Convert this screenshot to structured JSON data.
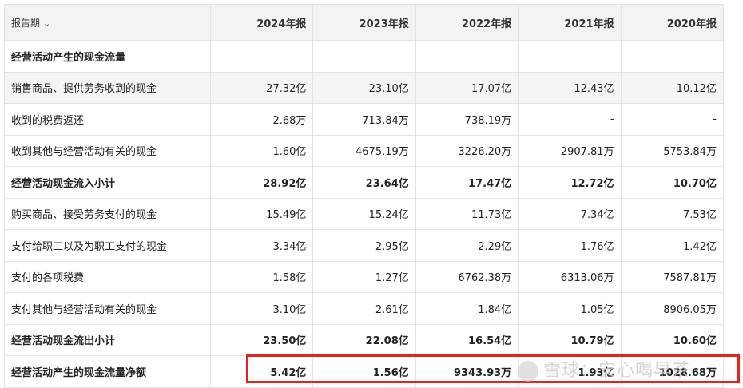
{
  "header": {
    "period_label": "报告期",
    "years": [
      "2024年报",
      "2023年报",
      "2022年报",
      "2021年报",
      "2020年报"
    ]
  },
  "rows": [
    {
      "name": "经营活动产生的现金流量",
      "values": [
        "",
        "",
        "",
        "",
        ""
      ]
    },
    {
      "name": "销售商品、提供劳务收到的现金",
      "values": [
        "27.32亿",
        "23.10亿",
        "17.07亿",
        "12.43亿",
        "10.12亿"
      ]
    },
    {
      "name": "收到的税费返还",
      "values": [
        "2.68万",
        "713.84万",
        "738.19万",
        "-",
        "-"
      ]
    },
    {
      "name": "收到其他与经营活动有关的现金",
      "values": [
        "1.60亿",
        "4675.19万",
        "3226.20万",
        "2907.81万",
        "5753.84万"
      ]
    },
    {
      "name": "经营活动现金流入小计",
      "values": [
        "28.92亿",
        "23.64亿",
        "17.47亿",
        "12.72亿",
        "10.70亿"
      ]
    },
    {
      "name": "购买商品、接受劳务支付的现金",
      "values": [
        "15.49亿",
        "15.24亿",
        "11.73亿",
        "7.34亿",
        "7.53亿"
      ]
    },
    {
      "name": "支付给职工以及为职工支付的现金",
      "values": [
        "3.34亿",
        "2.95亿",
        "2.29亿",
        "1.76亿",
        "1.42亿"
      ]
    },
    {
      "name": "支付的各项税费",
      "values": [
        "1.58亿",
        "1.27亿",
        "6762.38万",
        "6313.06万",
        "7587.81万"
      ]
    },
    {
      "name": "支付其他与经营活动有关的现金",
      "values": [
        "3.10亿",
        "2.61亿",
        "1.84亿",
        "1.05亿",
        "8906.05万"
      ]
    },
    {
      "name": "经营活动现金流出小计",
      "values": [
        "23.50亿",
        "22.08亿",
        "16.54亿",
        "10.79亿",
        "10.60亿"
      ]
    },
    {
      "name": "经营活动产生的现金流量净额",
      "values": [
        "5.42亿",
        "1.56亿",
        "9343.93万",
        "1.93亿",
        "1028.68万"
      ]
    }
  ],
  "watermark": "雪球：安心喝早茶",
  "colors": {
    "highlight_border": "#e8211a",
    "header_bg": "#f3f3f3",
    "alt_row_bg": "#f5f5f5"
  }
}
